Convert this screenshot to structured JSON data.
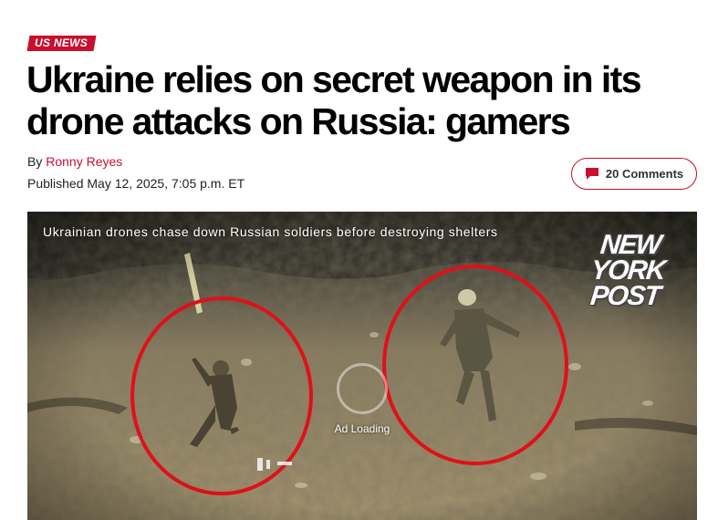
{
  "section": {
    "tag": "US NEWS"
  },
  "article": {
    "headline": "Ukraine relies on secret weapon in its drone attacks on Russia: gamers",
    "byline_prefix": "By ",
    "author": "Ronny Reyes",
    "published": "Published May 12, 2025, 7:05 p.m. ET"
  },
  "comments": {
    "label": "20 Comments",
    "icon": "comment-bubble-icon"
  },
  "video": {
    "caption": "Ukrainian drones chase down Russian soldiers before destroying shelters",
    "logo": {
      "line1": "NEW",
      "line2": "YORK",
      "line3": "POST"
    },
    "ad_loading": "Ad Loading"
  },
  "colors": {
    "brand_red": "#c8102e",
    "circle_red": "#e0101a"
  }
}
